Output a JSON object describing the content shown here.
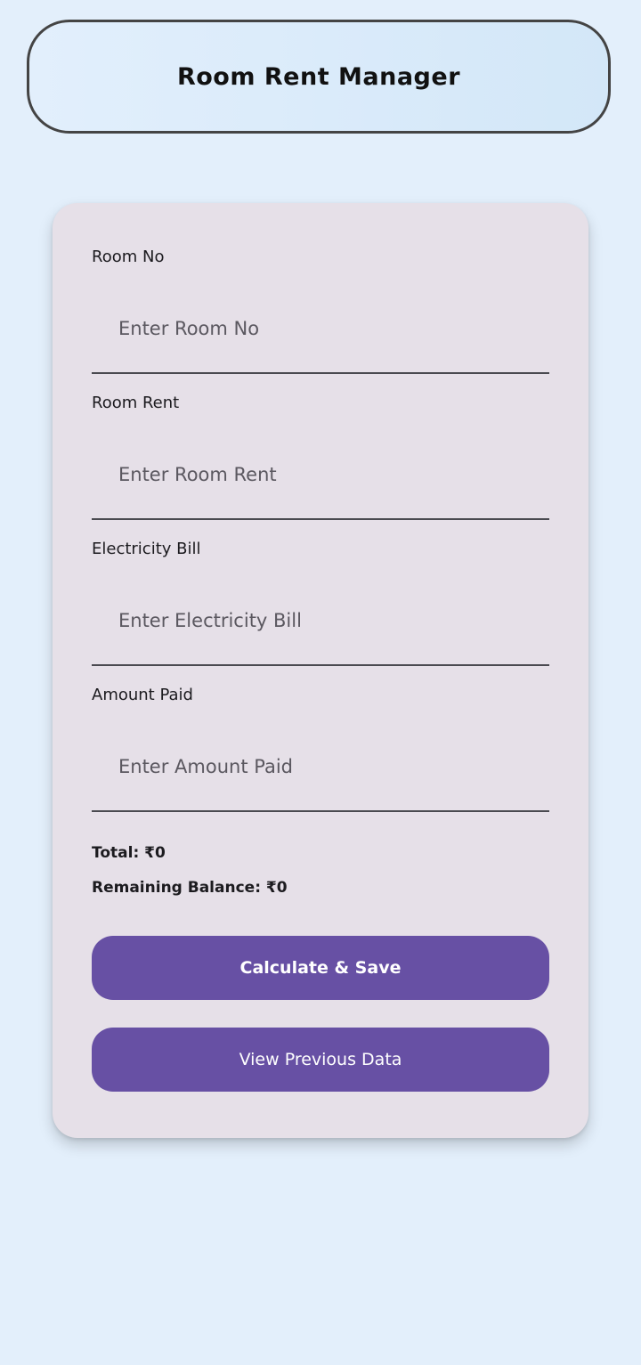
{
  "header": {
    "title": "Room Rent Manager"
  },
  "form": {
    "fields": [
      {
        "label": "Room No",
        "placeholder": "Enter Room No",
        "value": ""
      },
      {
        "label": "Room Rent",
        "placeholder": "Enter Room Rent",
        "value": ""
      },
      {
        "label": "Electricity Bill",
        "placeholder": "Enter Electricity Bill",
        "value": ""
      },
      {
        "label": "Amount Paid",
        "placeholder": "Enter Amount Paid",
        "value": ""
      }
    ]
  },
  "summary": {
    "total": "Total: ₹0",
    "remaining_balance": "Remaining Balance: ₹0"
  },
  "buttons": {
    "calculate_save": "Calculate & Save",
    "view_previous": "View Previous Data"
  },
  "colors": {
    "background": "#e3effb",
    "card": "#e6e0e8",
    "button": "#6750a4",
    "button_text": "#ffffff"
  }
}
